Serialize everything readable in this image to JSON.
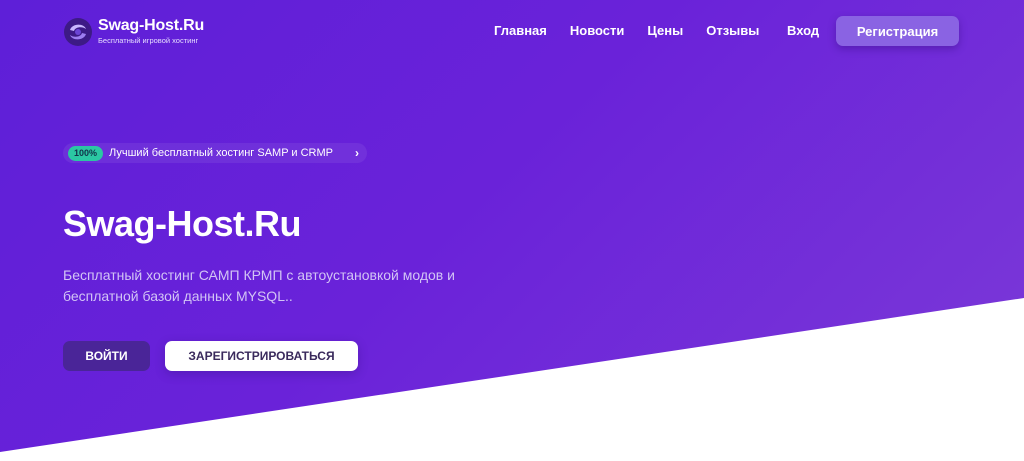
{
  "brand": {
    "name": "Swag-Host.Ru",
    "tagline": "Бесплатный игровой хостинг"
  },
  "nav": {
    "items": [
      {
        "label": "Главная"
      },
      {
        "label": "Новости"
      },
      {
        "label": "Цены"
      },
      {
        "label": "Отзывы"
      }
    ],
    "login_label": "Вход",
    "register_label": "Регистрация"
  },
  "hero": {
    "badge_pill": "100%",
    "badge_text": "Лучший бесплатный хостинг SAMP и CRMP",
    "title": "Swag-Host.Ru",
    "description": "Бесплатный хостинг САМП КРМП с автоустановкой модов и бесплатной базой данных MYSQL..",
    "login_button": "ВОЙТИ",
    "register_button": "ЗАРЕГИСТРИРОВАТЬСЯ"
  },
  "colors": {
    "hero_gradient_start": "#5e1fd8",
    "hero_gradient_end": "#7c3ad8",
    "accent_button": "#8a63e3",
    "pill": "#2bc7a3",
    "login_button": "#4a2598"
  },
  "icons": {
    "logo": "swirl-logo-icon",
    "badge_arrow": "chevron-right-icon"
  }
}
